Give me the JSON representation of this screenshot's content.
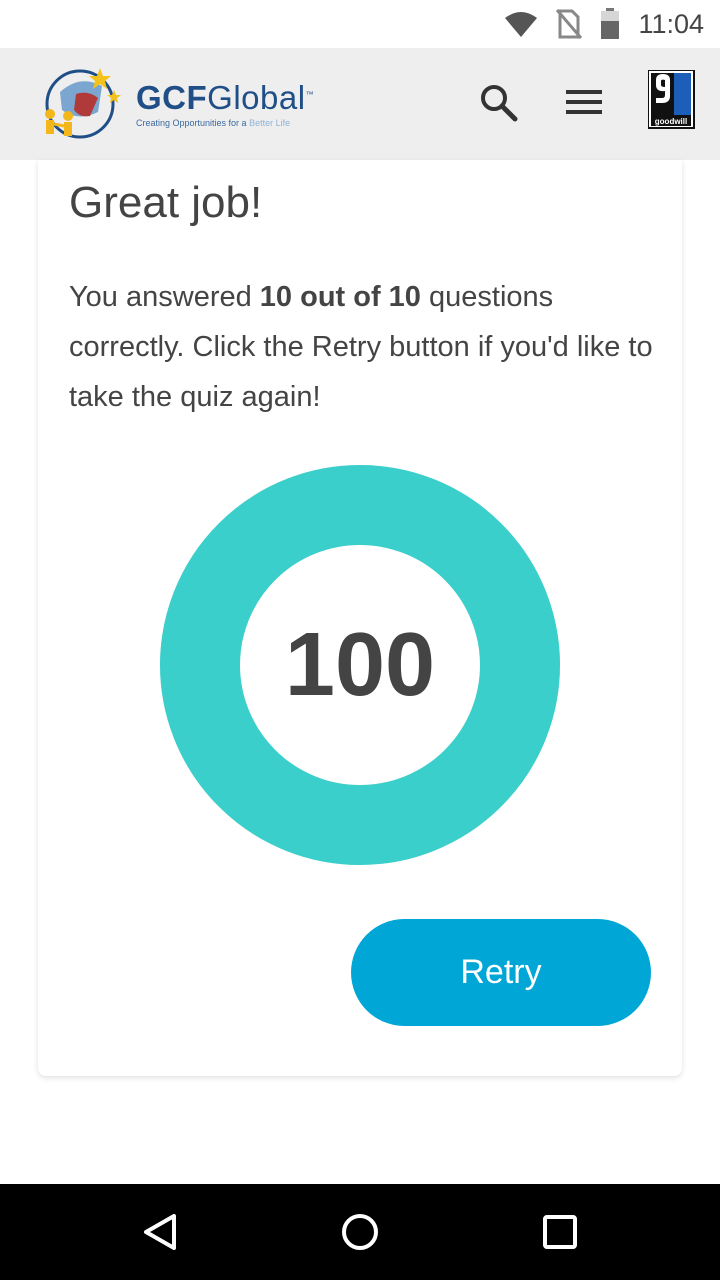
{
  "status_bar": {
    "time": "11:04",
    "icons": [
      "wifi-icon",
      "no-sim-icon",
      "battery-icon"
    ]
  },
  "header": {
    "logo": {
      "brand_bold": "GCF",
      "brand_rest": "Global",
      "trademark": "™",
      "tagline_main": "Creating Opportunities for a ",
      "tagline_accent": "Better Life"
    },
    "icons": [
      "search-icon",
      "menu-icon"
    ],
    "partner_logo_text": "goodwill"
  },
  "result": {
    "title": "Great job!",
    "message_before": "You answered ",
    "message_bold": "10 out of 10",
    "message_after": " questions correctly. Click the Retry button if you'd like to take the quiz again!",
    "score": "100",
    "score_fraction": 1.0,
    "retry_label": "Retry"
  },
  "nav": {
    "icons": [
      "back-icon",
      "home-icon",
      "recents-icon"
    ]
  },
  "colors": {
    "ring": "#3acfcb",
    "retry_button": "#00a6d6",
    "brand_blue": "#1f4f86",
    "header_bg": "#eeeeef"
  }
}
